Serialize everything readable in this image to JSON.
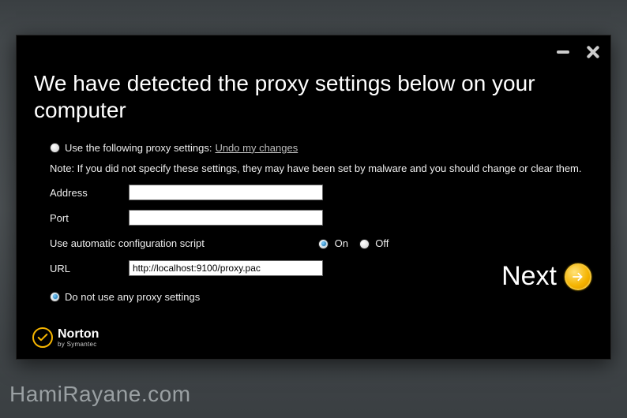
{
  "heading": "We have detected the proxy settings below on your computer",
  "option_use_label": "Use the following proxy settings:",
  "undo_label": "Undo my changes",
  "note": "Note: If you did not specify these settings, they may have been set by malware and you should change or clear them.",
  "fields": {
    "address_label": "Address",
    "address_value": "",
    "port_label": "Port",
    "port_value": "",
    "script_label": "Use automatic configuration script",
    "url_label": "URL",
    "url_value": "http://localhost:9100/proxy.pac"
  },
  "script_toggle": {
    "on_label": "On",
    "off_label": "Off",
    "selected": "on"
  },
  "option_noproxy_label": "Do not use any proxy settings",
  "proxy_mode_selected": "noproxy",
  "next_label": "Next",
  "brand": {
    "name": "Norton",
    "byline": "by Symantec"
  },
  "watermark": "HamiRayane.com",
  "colors": {
    "accent": "#f5b400",
    "radio_dot": "#1b7fc1"
  }
}
